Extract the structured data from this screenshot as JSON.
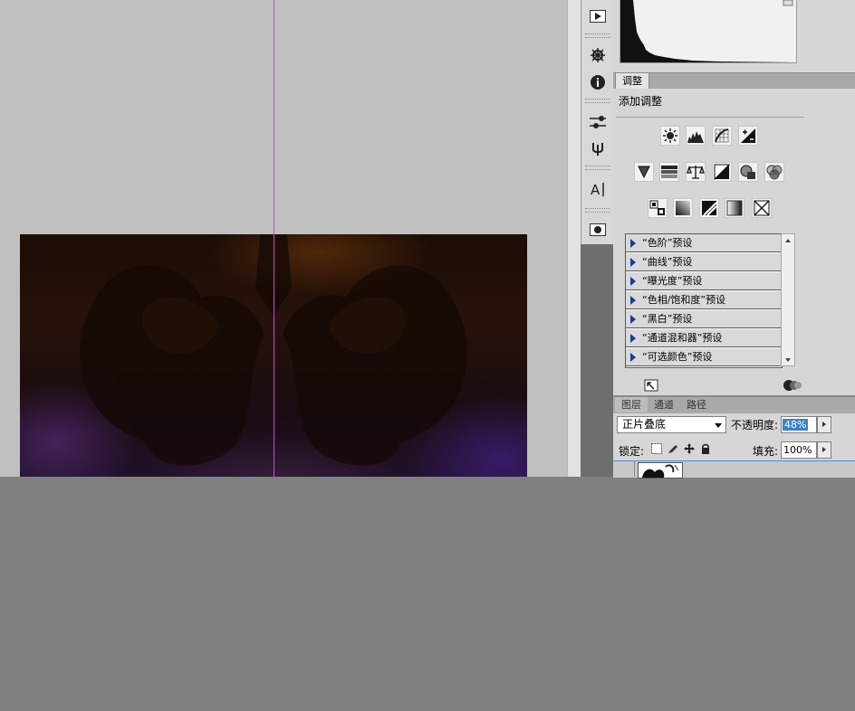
{
  "adjustments_panel": {
    "tab_label": "调整",
    "heading": "添加调整",
    "row1_icons": [
      "brightness-contrast-icon",
      "levels-icon",
      "curves-icon",
      "exposure-icon"
    ],
    "row2_icons": [
      "vibrance-icon",
      "hue-saturation-icon",
      "color-balance-icon",
      "black-white-icon",
      "photo-filter-icon",
      "channel-mixer-icon"
    ],
    "row3_icons": [
      "invert-icon",
      "posterize-icon",
      "threshold-icon",
      "gradient-map-icon",
      "selective-color-icon"
    ],
    "presets": [
      "“色阶”预设",
      "“曲线”预设",
      "“曝光度”预设",
      "“色相/饱和度”预设",
      "“黑白”预设",
      "“通道混和器”预设",
      "“可选颜色”预设"
    ]
  },
  "layers_panel": {
    "tabs": [
      "图层",
      "通道",
      "路径"
    ],
    "blend_mode": "正片叠底",
    "opacity_label": "不透明度:",
    "opacity_value": "48%",
    "lock_label": "锁定:",
    "fill_label": "填充:",
    "fill_value": "100%"
  },
  "colors": {
    "guide": "#d04bd0",
    "canvas_bg": "#c0c0c0",
    "selection": "#3d82c4"
  }
}
